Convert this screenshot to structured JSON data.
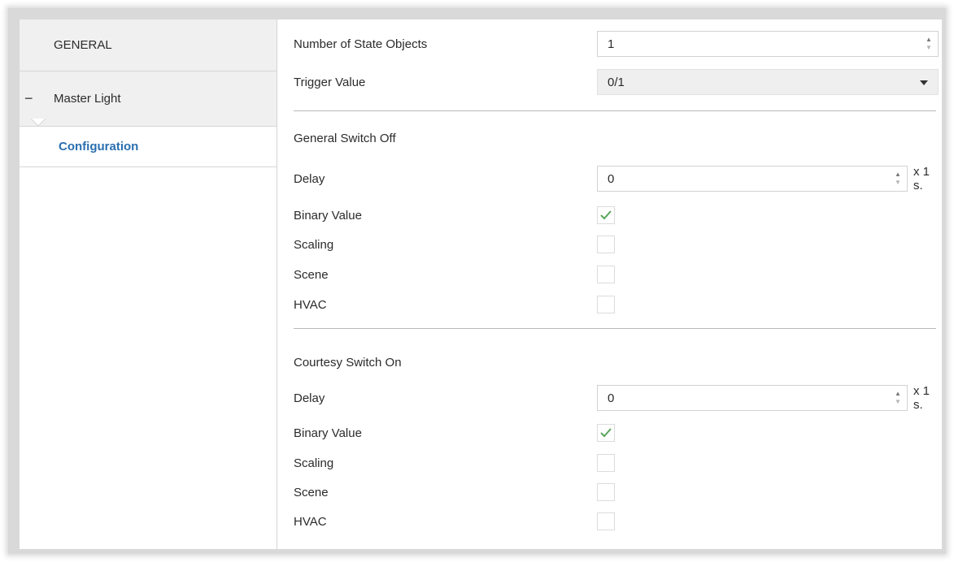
{
  "sidebar": {
    "items": [
      {
        "label": "GENERAL"
      },
      {
        "label": "Master Light",
        "collapse_glyph": "−"
      },
      {
        "label": "Configuration",
        "selected": true
      }
    ]
  },
  "main": {
    "state_objects": {
      "label": "Number of State Objects",
      "value": "1"
    },
    "trigger": {
      "label": "Trigger Value",
      "value": "0/1"
    },
    "general_off": {
      "title": "General Switch Off",
      "delay_label": "Delay",
      "delay_value": "0",
      "unit": "x 1 s.",
      "binary_label": "Binary Value",
      "scaling_label": "Scaling",
      "scene_label": "Scene",
      "hvac_label": "HVAC",
      "binary_checked": true,
      "scaling_checked": false,
      "scene_checked": false,
      "hvac_checked": false
    },
    "courtesy_on": {
      "title": "Courtesy Switch On",
      "delay_label": "Delay",
      "delay_value": "0",
      "unit": "x 1 s.",
      "binary_label": "Binary Value",
      "scaling_label": "Scaling",
      "scene_label": "Scene",
      "hvac_label": "HVAC",
      "binary_checked": true,
      "scaling_checked": false,
      "scene_checked": false,
      "hvac_checked": false
    }
  },
  "icons": {
    "check": "check-icon",
    "spin_up": "spin-up-icon",
    "spin_down": "spin-down-icon",
    "dropdown": "chevron-down-icon"
  },
  "colors": {
    "accent": "#2a6fb0",
    "check": "#5aa55a"
  }
}
